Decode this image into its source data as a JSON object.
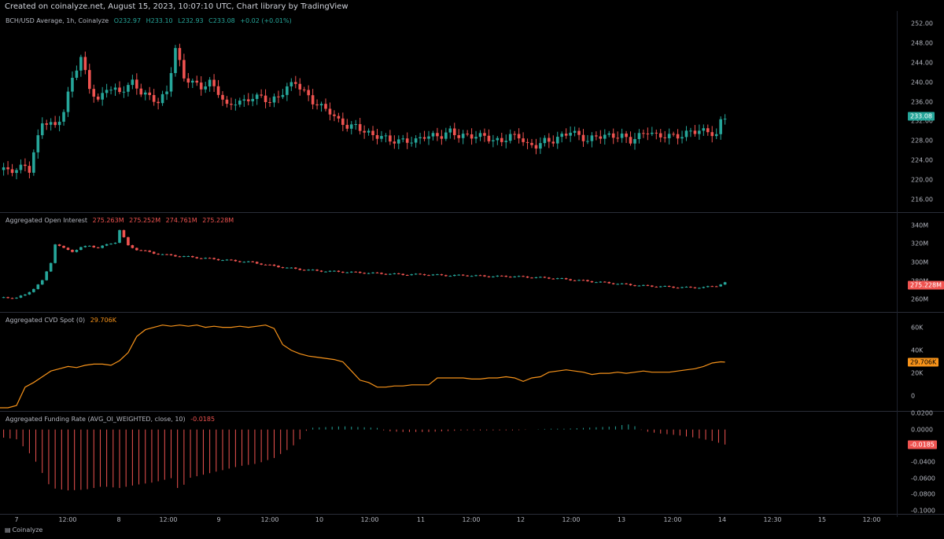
{
  "header": {
    "created": "Created on coinalyze.net, August 15, 2023, 10:07:10 UTC, Chart library by TradingView"
  },
  "footer": {
    "brand": "Coinalyze"
  },
  "colors": {
    "up": "#26a69a",
    "down": "#ef5350",
    "cvd": "#f7931a"
  },
  "x_axis": {
    "labels": [
      "7",
      "12:00",
      "8",
      "12:00",
      "9",
      "12:00",
      "10",
      "12:00",
      "11",
      "12:00",
      "12",
      "12:00",
      "13",
      "12:00",
      "14",
      "12:30",
      "15",
      "12:00"
    ]
  },
  "panes": {
    "price": {
      "legend": {
        "name": "BCH/USD Average, 1h, Coinalyze",
        "o": "O232.97",
        "h": "H233.10",
        "l": "L232.93",
        "c": "C233.08",
        "chg": "+0.02 (+0.01%)"
      },
      "ticks": [
        "252.00",
        "248.00",
        "244.00",
        "240.00",
        "236.00",
        "232.00",
        "228.00",
        "224.00",
        "220.00",
        "216.00"
      ],
      "last": "233.08"
    },
    "oi": {
      "legend": {
        "name": "Aggregated Open Interest",
        "o": "275.263M",
        "h": "275.252M",
        "l": "274.761M",
        "c": "275.228M"
      },
      "ticks": [
        "340M",
        "320M",
        "300M",
        "280M",
        "260M"
      ],
      "last": "275.228M"
    },
    "cvd": {
      "legend": {
        "name": "Aggregated CVD Spot (0)",
        "v": "29.706K"
      },
      "ticks": [
        "60K",
        "40K",
        "20K",
        "0"
      ],
      "last": "29.706K"
    },
    "funding": {
      "legend": {
        "name": "Aggregated Funding Rate (AVG_OI_WEIGHTED, close, 10)",
        "v": "-0.0185"
      },
      "ticks": [
        "0.0200",
        "0.0000",
        "-0.0200",
        "-0.0400",
        "-0.0600",
        "-0.0800",
        "-0.1000"
      ],
      "last": "-0.0185"
    }
  },
  "chart_data": [
    {
      "type": "candlestick",
      "title": "BCH/USD Average, 1h, Coinalyze",
      "ylim": [
        214,
        254
      ],
      "x_range_hours": [
        -6,
        198
      ],
      "anchors_t_close": [
        [
          0,
          222
        ],
        [
          2,
          223
        ],
        [
          3,
          222
        ],
        [
          6,
          232
        ],
        [
          9,
          231
        ],
        [
          11,
          234
        ],
        [
          13,
          241
        ],
        [
          15,
          245
        ],
        [
          17,
          239
        ],
        [
          19,
          236
        ],
        [
          21,
          239
        ],
        [
          24,
          238
        ],
        [
          27,
          240
        ],
        [
          29,
          238
        ],
        [
          31,
          237
        ],
        [
          33,
          236
        ],
        [
          35,
          238
        ],
        [
          37,
          247
        ],
        [
          39,
          241
        ],
        [
          41,
          240
        ],
        [
          43,
          239
        ],
        [
          45,
          240
        ],
        [
          47,
          238
        ],
        [
          49,
          235
        ],
        [
          51,
          236
        ],
        [
          53,
          236
        ],
        [
          55,
          237
        ],
        [
          57,
          237
        ],
        [
          59,
          236
        ],
        [
          61,
          237
        ],
        [
          63,
          239
        ],
        [
          65,
          240
        ],
        [
          67,
          238
        ],
        [
          69,
          236
        ],
        [
          71,
          235
        ],
        [
          73,
          234
        ],
        [
          75,
          232
        ],
        [
          77,
          231
        ],
        [
          79,
          231
        ],
        [
          81,
          230
        ],
        [
          83,
          229
        ],
        [
          85,
          229
        ],
        [
          87,
          228
        ],
        [
          89,
          228
        ],
        [
          91,
          228
        ],
        [
          93,
          228
        ],
        [
          95,
          229
        ],
        [
          97,
          229
        ],
        [
          99,
          229
        ],
        [
          101,
          230
        ],
        [
          103,
          229
        ],
        [
          105,
          229
        ],
        [
          107,
          229
        ],
        [
          109,
          229
        ],
        [
          111,
          228
        ],
        [
          113,
          228
        ],
        [
          115,
          229
        ],
        [
          117,
          229
        ],
        [
          119,
          227
        ],
        [
          121,
          227
        ],
        [
          123,
          228
        ],
        [
          125,
          228
        ],
        [
          127,
          229
        ],
        [
          129,
          230
        ],
        [
          131,
          229
        ],
        [
          133,
          228
        ],
        [
          135,
          229
        ],
        [
          137,
          229
        ],
        [
          139,
          229
        ],
        [
          141,
          229
        ],
        [
          143,
          228
        ],
        [
          145,
          229
        ],
        [
          147,
          230
        ],
        [
          149,
          229
        ],
        [
          151,
          229
        ],
        [
          153,
          229
        ],
        [
          155,
          229
        ],
        [
          157,
          230
        ],
        [
          159,
          230
        ],
        [
          161,
          230
        ],
        [
          163,
          229
        ],
        [
          164,
          232
        ],
        [
          165,
          233
        ]
      ],
      "last_close": 233.08
    },
    {
      "type": "candlestick",
      "title": "Aggregated Open Interest",
      "ylim": [
        250,
        350
      ],
      "x_range_hours": [
        -6,
        198
      ],
      "anchors_t_close": [
        [
          0,
          262
        ],
        [
          2,
          265
        ],
        [
          4,
          272
        ],
        [
          6,
          280
        ],
        [
          8,
          300
        ],
        [
          9,
          320
        ],
        [
          11,
          315
        ],
        [
          13,
          312
        ],
        [
          15,
          316
        ],
        [
          17,
          318
        ],
        [
          19,
          316
        ],
        [
          21,
          319
        ],
        [
          23,
          322
        ],
        [
          24,
          335
        ],
        [
          26,
          318
        ],
        [
          28,
          314
        ],
        [
          30,
          312
        ],
        [
          32,
          310
        ],
        [
          35,
          308
        ],
        [
          40,
          306
        ],
        [
          45,
          304
        ],
        [
          50,
          302
        ],
        [
          55,
          300
        ],
        [
          60,
          296
        ],
        [
          65,
          293
        ],
        [
          70,
          291
        ],
        [
          75,
          290
        ],
        [
          80,
          289
        ],
        [
          85,
          288
        ],
        [
          90,
          287
        ],
        [
          95,
          287
        ],
        [
          100,
          286
        ],
        [
          105,
          286
        ],
        [
          110,
          285
        ],
        [
          115,
          285
        ],
        [
          120,
          284
        ],
        [
          125,
          283
        ],
        [
          130,
          281
        ],
        [
          135,
          279
        ],
        [
          140,
          277
        ],
        [
          145,
          275
        ],
        [
          150,
          274
        ],
        [
          155,
          273
        ],
        [
          160,
          273
        ],
        [
          163,
          275
        ],
        [
          165,
          278
        ]
      ],
      "last": 275.228
    },
    {
      "type": "line",
      "title": "Aggregated CVD Spot (0)",
      "ylim": [
        -10000,
        70000
      ],
      "x_range_hours": [
        -6,
        198
      ],
      "points": [
        [
          -6,
          -10000
        ],
        [
          -2,
          -10000
        ],
        [
          0,
          -8000
        ],
        [
          2,
          8000
        ],
        [
          4,
          12000
        ],
        [
          6,
          17000
        ],
        [
          8,
          22000
        ],
        [
          10,
          24000
        ],
        [
          12,
          26000
        ],
        [
          14,
          25000
        ],
        [
          16,
          27000
        ],
        [
          18,
          28000
        ],
        [
          20,
          28000
        ],
        [
          22,
          27000
        ],
        [
          24,
          31000
        ],
        [
          26,
          38000
        ],
        [
          28,
          52000
        ],
        [
          30,
          58000
        ],
        [
          32,
          60000
        ],
        [
          34,
          62000
        ],
        [
          36,
          61000
        ],
        [
          38,
          62000
        ],
        [
          40,
          61000
        ],
        [
          42,
          62000
        ],
        [
          44,
          60000
        ],
        [
          46,
          61000
        ],
        [
          48,
          60000
        ],
        [
          50,
          60000
        ],
        [
          52,
          61000
        ],
        [
          54,
          60000
        ],
        [
          56,
          61000
        ],
        [
          58,
          62000
        ],
        [
          60,
          59000
        ],
        [
          62,
          45000
        ],
        [
          64,
          40000
        ],
        [
          66,
          37000
        ],
        [
          68,
          35000
        ],
        [
          70,
          34000
        ],
        [
          72,
          33000
        ],
        [
          74,
          32000
        ],
        [
          76,
          30000
        ],
        [
          78,
          22000
        ],
        [
          80,
          14000
        ],
        [
          82,
          12000
        ],
        [
          84,
          8000
        ],
        [
          86,
          8000
        ],
        [
          88,
          9000
        ],
        [
          90,
          9000
        ],
        [
          92,
          10000
        ],
        [
          94,
          10000
        ],
        [
          96,
          10000
        ],
        [
          98,
          16000
        ],
        [
          100,
          16000
        ],
        [
          102,
          16000
        ],
        [
          104,
          16000
        ],
        [
          106,
          15000
        ],
        [
          108,
          15000
        ],
        [
          110,
          16000
        ],
        [
          112,
          16000
        ],
        [
          114,
          17000
        ],
        [
          116,
          16000
        ],
        [
          118,
          13000
        ],
        [
          120,
          16000
        ],
        [
          122,
          17000
        ],
        [
          124,
          21000
        ],
        [
          126,
          22000
        ],
        [
          128,
          23000
        ],
        [
          130,
          22000
        ],
        [
          132,
          21000
        ],
        [
          134,
          19000
        ],
        [
          136,
          20000
        ],
        [
          138,
          20000
        ],
        [
          140,
          21000
        ],
        [
          142,
          20000
        ],
        [
          144,
          21000
        ],
        [
          146,
          22000
        ],
        [
          148,
          21000
        ],
        [
          150,
          21000
        ],
        [
          152,
          21000
        ],
        [
          154,
          22000
        ],
        [
          156,
          23000
        ],
        [
          158,
          24000
        ],
        [
          160,
          26000
        ],
        [
          162,
          29000
        ],
        [
          164,
          30000
        ],
        [
          165,
          29706
        ]
      ],
      "last": 29706
    },
    {
      "type": "bar",
      "title": "Aggregated Funding Rate (AVG_OI_WEIGHTED, close, 10)",
      "ylim": [
        -0.1,
        0.02
      ],
      "x_range_hours": [
        -6,
        198
      ],
      "anchors_t_value": [
        [
          -6,
          -0.008
        ],
        [
          0,
          -0.012
        ],
        [
          4,
          -0.035
        ],
        [
          8,
          -0.072
        ],
        [
          12,
          -0.075
        ],
        [
          16,
          -0.074
        ],
        [
          20,
          -0.07
        ],
        [
          24,
          -0.072
        ],
        [
          28,
          -0.068
        ],
        [
          32,
          -0.065
        ],
        [
          36,
          -0.06
        ],
        [
          38,
          -0.076
        ],
        [
          40,
          -0.06
        ],
        [
          44,
          -0.055
        ],
        [
          48,
          -0.05
        ],
        [
          52,
          -0.045
        ],
        [
          56,
          -0.042
        ],
        [
          60,
          -0.035
        ],
        [
          64,
          -0.022
        ],
        [
          66,
          -0.012
        ],
        [
          68,
          0.002
        ],
        [
          72,
          0.003
        ],
        [
          76,
          0.004
        ],
        [
          80,
          0.003
        ],
        [
          84,
          0.002
        ],
        [
          86,
          -0.002
        ],
        [
          90,
          -0.003
        ],
        [
          96,
          -0.003
        ],
        [
          100,
          -0.002
        ],
        [
          104,
          -0.001
        ],
        [
          108,
          -0.001
        ],
        [
          112,
          -0.001
        ],
        [
          116,
          -0.001
        ],
        [
          120,
          0.0
        ],
        [
          124,
          0.001
        ],
        [
          128,
          0.001
        ],
        [
          132,
          0.002
        ],
        [
          136,
          0.003
        ],
        [
          140,
          0.004
        ],
        [
          142,
          0.007
        ],
        [
          144,
          0.004
        ],
        [
          146,
          -0.002
        ],
        [
          150,
          -0.005
        ],
        [
          154,
          -0.007
        ],
        [
          158,
          -0.01
        ],
        [
          162,
          -0.014
        ],
        [
          165,
          -0.0185
        ]
      ],
      "last": -0.0185
    }
  ]
}
